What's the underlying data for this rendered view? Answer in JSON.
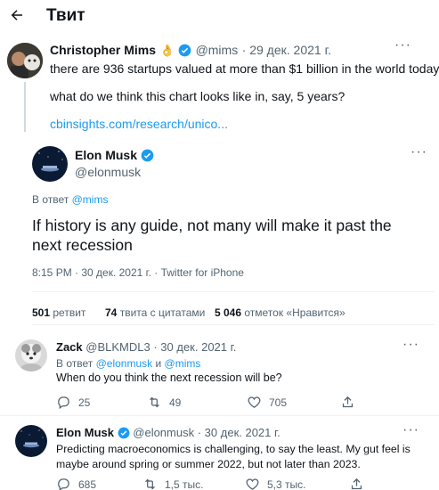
{
  "header": {
    "title": "Твит"
  },
  "quoted": {
    "name": "Christopher Mims",
    "emoji": "👌",
    "handle": "@mims",
    "date": "· 29 дек. 2021 г.",
    "line1": "there are 936 startups valued at more than $1 billion in the world today",
    "line2": "what do we think this chart looks like in, say, 5 years?",
    "link": "cbinsights.com/research/unico..."
  },
  "main": {
    "name": "Elon Musk",
    "handle": "@elonmusk",
    "reply_prefix": "В ответ",
    "reply_to": "@mims",
    "text_line1": "If history is any guide, not many will make it past the",
    "text_line2": "next recession",
    "time": "8:15 PM · 30 дек. 2021 г. · Twitter for iPhone",
    "stats": {
      "retweets": "501",
      "retweets_label": "ретвит",
      "quotes": "74",
      "quotes_label": "твита с цитатами",
      "likes": "5 046",
      "likes_label": "отметок «Нравится»"
    }
  },
  "reply1": {
    "name": "Zack",
    "handle": "@BLKMDL3",
    "date": "· 30 дек. 2021 г.",
    "reply_prefix": "В ответ",
    "reply_to_1": "@elonmusk",
    "reply_and": "и",
    "reply_to_2": "@mims",
    "text": "When do you think the next recession will be?",
    "counts": {
      "replies": "25",
      "retweets": "49",
      "likes": "705"
    }
  },
  "reply2": {
    "name": "Elon Musk",
    "handle": "@elonmusk",
    "date": "· 30 дек. 2021 г.",
    "text_line1": "Predicting macroeconomics is challenging, to say the least. My gut feel is",
    "text_line2": "maybe around spring or summer 2022, but not later than 2023.",
    "counts": {
      "replies": "685",
      "retweets": "1,5 тыс.",
      "likes": "5,3 тыс."
    }
  },
  "colors": {
    "accent": "#1d9bf0",
    "muted": "#536471",
    "divider": "#eff3f4"
  }
}
